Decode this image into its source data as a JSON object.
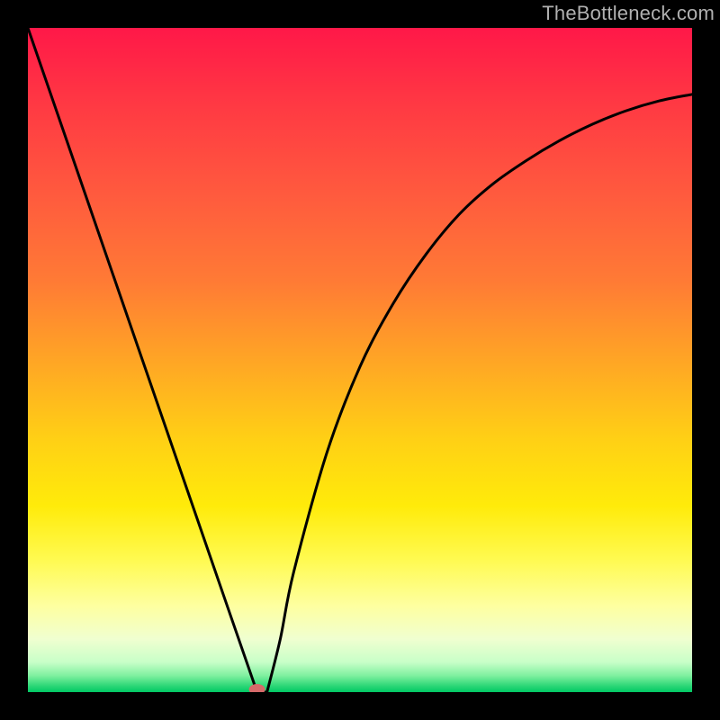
{
  "watermark": "TheBottleneck.com",
  "chart_data": {
    "type": "line",
    "xlabel": "",
    "ylabel": "",
    "xlim": [
      0,
      100
    ],
    "ylim": [
      0,
      100
    ],
    "grid": false,
    "series": [
      {
        "name": "curve",
        "x": [
          0,
          5,
          10,
          15,
          20,
          25,
          30,
          34.5,
          36,
          38,
          40,
          45,
          50,
          55,
          60,
          65,
          70,
          75,
          80,
          85,
          90,
          95,
          100
        ],
        "values": [
          100,
          85.5,
          71,
          56.5,
          42,
          27.5,
          13,
          0,
          0,
          8,
          18,
          36,
          49,
          58.5,
          66,
          72,
          76.5,
          80,
          83,
          85.5,
          87.5,
          89,
          90
        ]
      }
    ],
    "marker": {
      "x": 34.5,
      "y": 0,
      "color": "#d66a6a"
    },
    "background_gradient": {
      "type": "vertical",
      "stops": [
        {
          "pos": 0.0,
          "color": "#ff1848"
        },
        {
          "pos": 0.12,
          "color": "#ff3a43"
        },
        {
          "pos": 0.25,
          "color": "#ff5a3e"
        },
        {
          "pos": 0.38,
          "color": "#ff7a35"
        },
        {
          "pos": 0.5,
          "color": "#ffa525"
        },
        {
          "pos": 0.62,
          "color": "#ffd015"
        },
        {
          "pos": 0.72,
          "color": "#ffeb0a"
        },
        {
          "pos": 0.8,
          "color": "#fffa50"
        },
        {
          "pos": 0.87,
          "color": "#feffa0"
        },
        {
          "pos": 0.92,
          "color": "#f0ffd0"
        },
        {
          "pos": 0.955,
          "color": "#c8ffc8"
        },
        {
          "pos": 0.975,
          "color": "#80f0a0"
        },
        {
          "pos": 0.99,
          "color": "#30d878"
        },
        {
          "pos": 1.0,
          "color": "#00c864"
        }
      ]
    }
  }
}
